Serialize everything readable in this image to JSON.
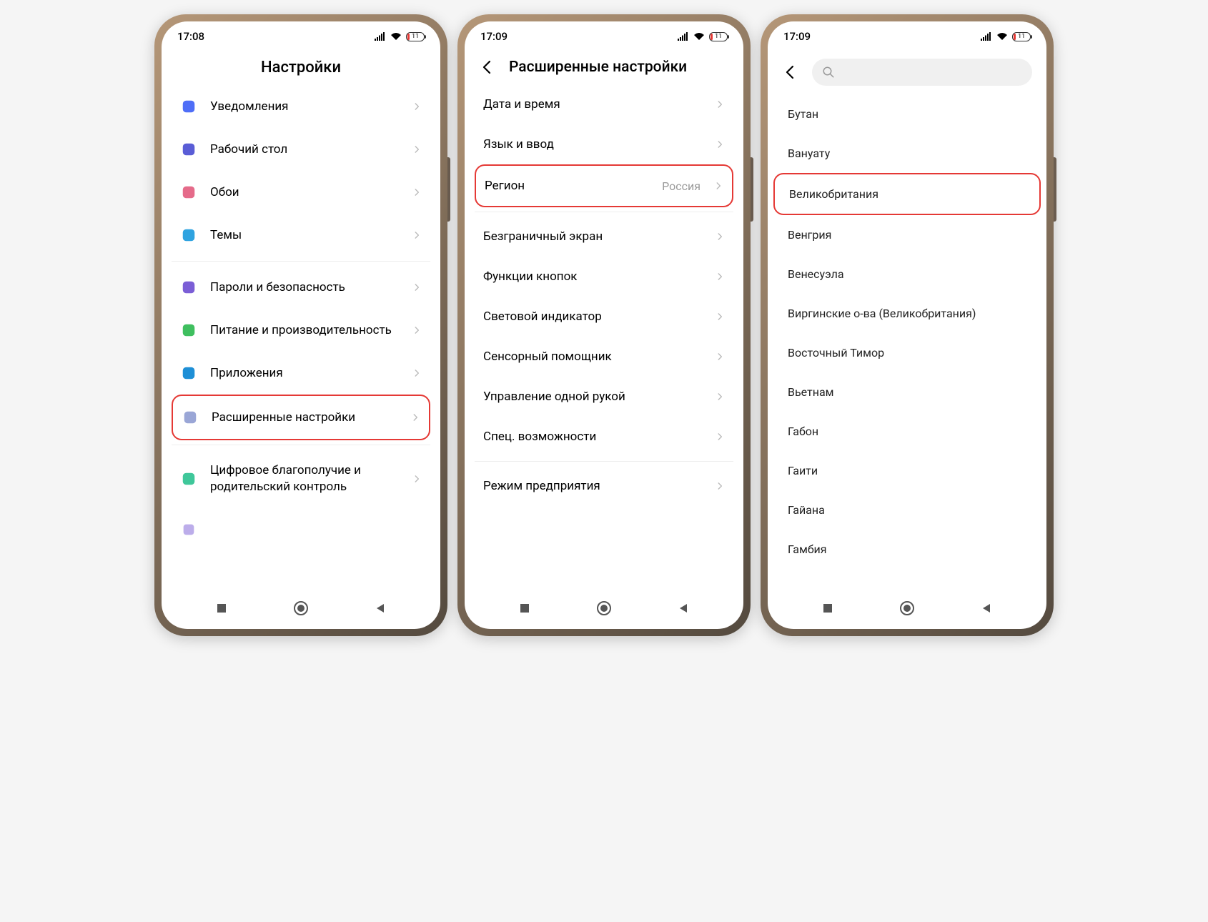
{
  "status": {
    "time1": "17:08",
    "time2": "17:09",
    "time3": "17:09",
    "battery": "11"
  },
  "screen1": {
    "title": "Настройки",
    "items": [
      {
        "label": "Уведомления",
        "icon": "#4f6ef7"
      },
      {
        "label": "Рабочий стол",
        "icon": "#5a5dd6"
      },
      {
        "label": "Обои",
        "icon": "#e56b8a"
      },
      {
        "label": "Темы",
        "icon": "#2fa3e0"
      }
    ],
    "items2": [
      {
        "label": "Пароли и безопасность",
        "icon": "#7b5ed6"
      },
      {
        "label": "Питание и производительность",
        "icon": "#3fbf5f"
      },
      {
        "label": "Приложения",
        "icon": "#1e8fd6"
      },
      {
        "label": "Расширенные настройки",
        "icon": "#9aa6d6",
        "hl": true
      }
    ],
    "items3": [
      {
        "label": "Цифровое благополучие и родительский контроль",
        "icon": "#3fc79a"
      }
    ]
  },
  "screen2": {
    "title": "Расширенные настройки",
    "group1": [
      {
        "label": "Дата и время"
      },
      {
        "label": "Язык и ввод"
      },
      {
        "label": "Регион",
        "value": "Россия",
        "hl": true
      }
    ],
    "group2": [
      {
        "label": "Безграничный экран"
      },
      {
        "label": "Функции кнопок"
      },
      {
        "label": "Световой индикатор"
      },
      {
        "label": "Сенсорный помощник"
      },
      {
        "label": "Управление одной рукой"
      },
      {
        "label": "Спец. возможности"
      }
    ],
    "group3": [
      {
        "label": "Режим предприятия"
      }
    ]
  },
  "screen3": {
    "countries": [
      {
        "label": "Бутан"
      },
      {
        "label": "Вануату"
      },
      {
        "label": "Великобритания",
        "hl": true
      },
      {
        "label": "Венгрия"
      },
      {
        "label": "Венесуэла"
      },
      {
        "label": "Виргинские о-ва (Великобритания)"
      },
      {
        "label": "Восточный Тимор"
      },
      {
        "label": "Вьетнам"
      },
      {
        "label": "Габон"
      },
      {
        "label": "Гаити"
      },
      {
        "label": "Гайана"
      },
      {
        "label": "Гамбия"
      }
    ]
  }
}
